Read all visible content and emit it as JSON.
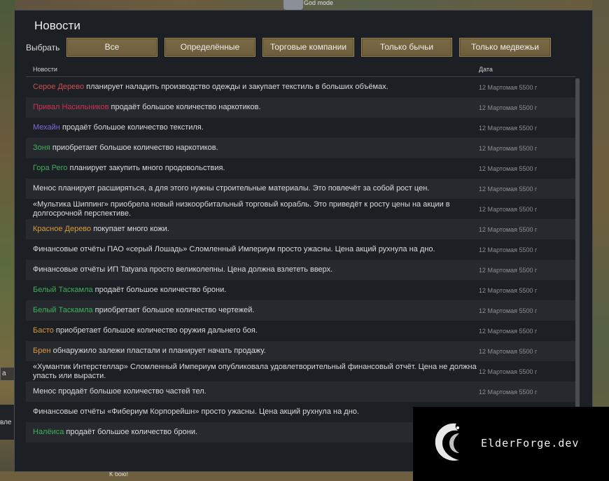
{
  "window": {
    "title": "Новости",
    "filter_label": "Выбрать",
    "filters": [
      "Все",
      "Определённые",
      "Торговые компании",
      "Только бычьи",
      "Только медвежьи"
    ],
    "columns": {
      "news": "Новости",
      "date": "Дата"
    }
  },
  "colors": {
    "red": "#d04a4a",
    "crimson": "#d23a55",
    "violet": "#7a6ad8",
    "green": "#3fae5a",
    "orange": "#d99a3a",
    "default": "#dcdcdc"
  },
  "news": [
    {
      "name": "Серое Дерево",
      "name_color": "#d05050",
      "text": " планирует наладить производство одежды и закупает текстиль в больших объёмах.",
      "date": "12 Мартомая 5500 г"
    },
    {
      "name": "Привал Насильников",
      "name_color": "#d0304f",
      "text": " продаёт большое количество наркотиков.",
      "date": "12 Мартомая 5500 г"
    },
    {
      "name": "Мехайн",
      "name_color": "#7e6ad8",
      "text": " продаёт большое количество текстиля.",
      "date": "12 Мартомая 5500 г"
    },
    {
      "name": "Зоня",
      "name_color": "#3fae5a",
      "text": " приобретает большое количество наркотиков.",
      "date": "12 Мартомая 5500 г"
    },
    {
      "name": "Гора Рего",
      "name_color": "#3fae5a",
      "text": " планирует закупить много продовольствия.",
      "date": "12 Мартомая 5500 г"
    },
    {
      "name": "",
      "name_color": "#dcdcdc",
      "text": "Менос планирует расширяться, а для этого нужны строительные материалы. Это повлечёт за собой рост цен.",
      "date": "12 Мартомая 5500 г"
    },
    {
      "name": "",
      "name_color": "#dcdcdc",
      "text": "«Мультика Шиппинг» приобрела новый низкоорбитальный торговый корабль. Это приведёт к росту цены на акции в долгосрочной перспективе.",
      "date": "12 Мартомая 5500 г"
    },
    {
      "name": "Красное Дерево",
      "name_color": "#d99a3a",
      "text": " покупает много кожи.",
      "date": "12 Мартомая 5500 г"
    },
    {
      "name": "",
      "name_color": "#dcdcdc",
      "text": "Финансовые отчёты ПАО «серый Лошадь» Сломленный Империум просто ужасны. Цена акций рухнула на дно.",
      "date": "12 Мартомая 5500 г"
    },
    {
      "name": "",
      "name_color": "#dcdcdc",
      "text": "Финансовые отчёты ИП Tatyana просто великолепны. Цена должна взлететь вверх.",
      "date": "12 Мартомая 5500 г"
    },
    {
      "name": "Белый Таскамла",
      "name_color": "#3fae5a",
      "text": " продаёт большое количество брони.",
      "date": "12 Мартомая 5500 г"
    },
    {
      "name": "Белый Таскамла",
      "name_color": "#3fae5a",
      "text": " приобретает большое количество чертежей.",
      "date": "12 Мартомая 5500 г"
    },
    {
      "name": "Басто",
      "name_color": "#d99a3a",
      "text": " приобретает большое количество оружия дальнего боя.",
      "date": "12 Мартомая 5500 г"
    },
    {
      "name": "Брен",
      "name_color": "#d99a3a",
      "text": " обнаружило залежи пластали и планирует начать продажу.",
      "date": "12 Мартомая 5500 г"
    },
    {
      "name": "",
      "name_color": "#dcdcdc",
      "text": "«Хумантик Интерстеллар» Сломленный Империум опубликовала удовлетворительный финансовый отчёт. Цена не должна упасть или вырасти.",
      "date": "12 Мартомая 5500 г"
    },
    {
      "name": "",
      "name_color": "#dcdcdc",
      "text": "Менос продаёт большое количество частей тел.",
      "date": "12 Мартомая 5500 г"
    },
    {
      "name": "",
      "name_color": "#dcdcdc",
      "text": "Финансовые отчёты «Фибериум Корпорейшн» просто ужасны. Цена акций рухнула на дно.",
      "date": ""
    },
    {
      "name": "Налёиса",
      "name_color": "#3fae5a",
      "text": " продаёт большое количество брони.",
      "date": ""
    }
  ],
  "game": {
    "godmode_label": "God mode",
    "left_button": "а",
    "left_text": "вле",
    "bottom_hint": "К бою!"
  },
  "watermark": {
    "text": "ElderForge.dev"
  }
}
